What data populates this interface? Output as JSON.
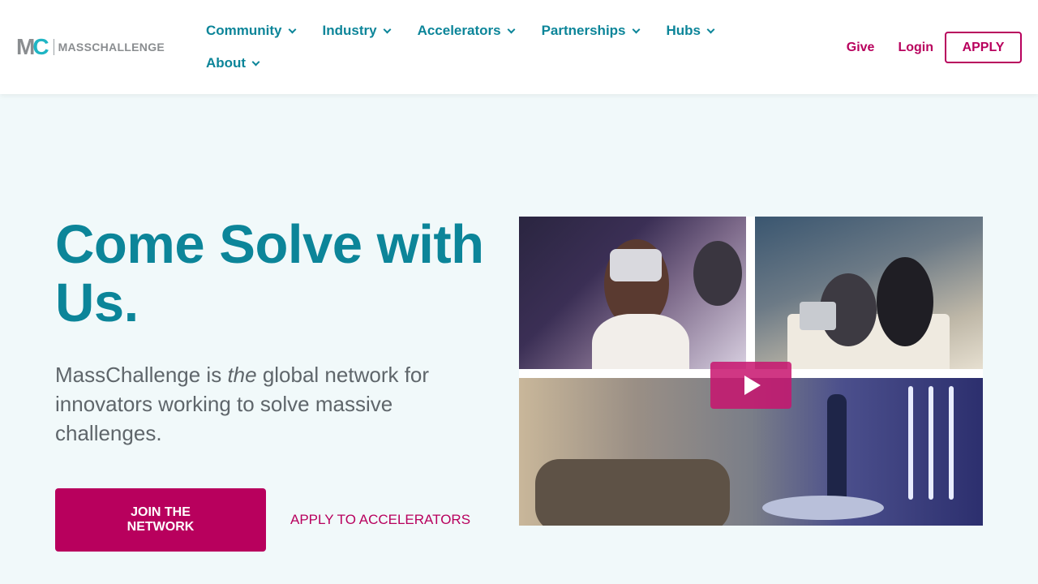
{
  "brand": {
    "logo_text": "MASSCHALLENGE"
  },
  "nav": {
    "items": [
      {
        "label": "Community"
      },
      {
        "label": "Industry"
      },
      {
        "label": "Accelerators"
      },
      {
        "label": "Partnerships"
      },
      {
        "label": "Hubs"
      },
      {
        "label": "About"
      }
    ]
  },
  "actions": {
    "give": "Give",
    "login": "Login",
    "apply": "APPLY"
  },
  "hero": {
    "title": "Come Solve with Us.",
    "desc_before": "MassChallenge is ",
    "desc_em": "the",
    "desc_after": " global network for innovators working to solve massive challenges.",
    "join_button": "JOIN THE NETWORK",
    "apply_link": "APPLY TO ACCELERATORS"
  },
  "icons": {
    "nav_chevron": "chevron-down-icon",
    "video_play": "play-icon"
  },
  "colors": {
    "primary_teal": "#0c8599",
    "accent_magenta": "#b8005d",
    "hero_bg": "#f1f9fa"
  }
}
